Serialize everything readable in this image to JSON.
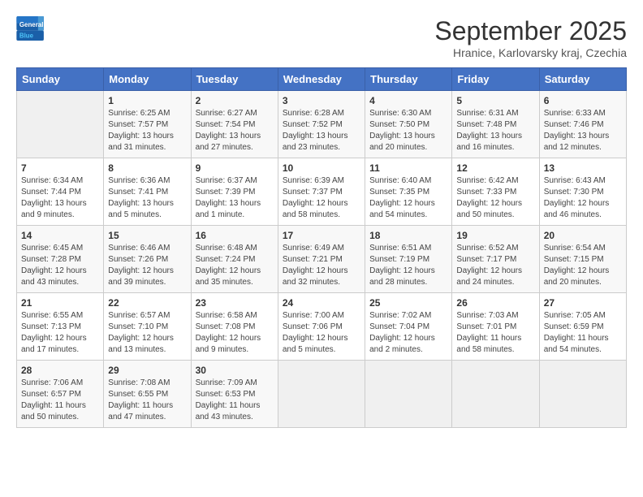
{
  "header": {
    "logo_general": "General",
    "logo_blue": "Blue",
    "month": "September 2025",
    "location": "Hranice, Karlovarsky kraj, Czechia"
  },
  "weekdays": [
    "Sunday",
    "Monday",
    "Tuesday",
    "Wednesday",
    "Thursday",
    "Friday",
    "Saturday"
  ],
  "weeks": [
    [
      {
        "day": "",
        "content": ""
      },
      {
        "day": "1",
        "content": "Sunrise: 6:25 AM\nSunset: 7:57 PM\nDaylight: 13 hours\nand 31 minutes."
      },
      {
        "day": "2",
        "content": "Sunrise: 6:27 AM\nSunset: 7:54 PM\nDaylight: 13 hours\nand 27 minutes."
      },
      {
        "day": "3",
        "content": "Sunrise: 6:28 AM\nSunset: 7:52 PM\nDaylight: 13 hours\nand 23 minutes."
      },
      {
        "day": "4",
        "content": "Sunrise: 6:30 AM\nSunset: 7:50 PM\nDaylight: 13 hours\nand 20 minutes."
      },
      {
        "day": "5",
        "content": "Sunrise: 6:31 AM\nSunset: 7:48 PM\nDaylight: 13 hours\nand 16 minutes."
      },
      {
        "day": "6",
        "content": "Sunrise: 6:33 AM\nSunset: 7:46 PM\nDaylight: 13 hours\nand 12 minutes."
      }
    ],
    [
      {
        "day": "7",
        "content": "Sunrise: 6:34 AM\nSunset: 7:44 PM\nDaylight: 13 hours\nand 9 minutes."
      },
      {
        "day": "8",
        "content": "Sunrise: 6:36 AM\nSunset: 7:41 PM\nDaylight: 13 hours\nand 5 minutes."
      },
      {
        "day": "9",
        "content": "Sunrise: 6:37 AM\nSunset: 7:39 PM\nDaylight: 13 hours\nand 1 minute."
      },
      {
        "day": "10",
        "content": "Sunrise: 6:39 AM\nSunset: 7:37 PM\nDaylight: 12 hours\nand 58 minutes."
      },
      {
        "day": "11",
        "content": "Sunrise: 6:40 AM\nSunset: 7:35 PM\nDaylight: 12 hours\nand 54 minutes."
      },
      {
        "day": "12",
        "content": "Sunrise: 6:42 AM\nSunset: 7:33 PM\nDaylight: 12 hours\nand 50 minutes."
      },
      {
        "day": "13",
        "content": "Sunrise: 6:43 AM\nSunset: 7:30 PM\nDaylight: 12 hours\nand 46 minutes."
      }
    ],
    [
      {
        "day": "14",
        "content": "Sunrise: 6:45 AM\nSunset: 7:28 PM\nDaylight: 12 hours\nand 43 minutes."
      },
      {
        "day": "15",
        "content": "Sunrise: 6:46 AM\nSunset: 7:26 PM\nDaylight: 12 hours\nand 39 minutes."
      },
      {
        "day": "16",
        "content": "Sunrise: 6:48 AM\nSunset: 7:24 PM\nDaylight: 12 hours\nand 35 minutes."
      },
      {
        "day": "17",
        "content": "Sunrise: 6:49 AM\nSunset: 7:21 PM\nDaylight: 12 hours\nand 32 minutes."
      },
      {
        "day": "18",
        "content": "Sunrise: 6:51 AM\nSunset: 7:19 PM\nDaylight: 12 hours\nand 28 minutes."
      },
      {
        "day": "19",
        "content": "Sunrise: 6:52 AM\nSunset: 7:17 PM\nDaylight: 12 hours\nand 24 minutes."
      },
      {
        "day": "20",
        "content": "Sunrise: 6:54 AM\nSunset: 7:15 PM\nDaylight: 12 hours\nand 20 minutes."
      }
    ],
    [
      {
        "day": "21",
        "content": "Sunrise: 6:55 AM\nSunset: 7:13 PM\nDaylight: 12 hours\nand 17 minutes."
      },
      {
        "day": "22",
        "content": "Sunrise: 6:57 AM\nSunset: 7:10 PM\nDaylight: 12 hours\nand 13 minutes."
      },
      {
        "day": "23",
        "content": "Sunrise: 6:58 AM\nSunset: 7:08 PM\nDaylight: 12 hours\nand 9 minutes."
      },
      {
        "day": "24",
        "content": "Sunrise: 7:00 AM\nSunset: 7:06 PM\nDaylight: 12 hours\nand 5 minutes."
      },
      {
        "day": "25",
        "content": "Sunrise: 7:02 AM\nSunset: 7:04 PM\nDaylight: 12 hours\nand 2 minutes."
      },
      {
        "day": "26",
        "content": "Sunrise: 7:03 AM\nSunset: 7:01 PM\nDaylight: 11 hours\nand 58 minutes."
      },
      {
        "day": "27",
        "content": "Sunrise: 7:05 AM\nSunset: 6:59 PM\nDaylight: 11 hours\nand 54 minutes."
      }
    ],
    [
      {
        "day": "28",
        "content": "Sunrise: 7:06 AM\nSunset: 6:57 PM\nDaylight: 11 hours\nand 50 minutes."
      },
      {
        "day": "29",
        "content": "Sunrise: 7:08 AM\nSunset: 6:55 PM\nDaylight: 11 hours\nand 47 minutes."
      },
      {
        "day": "30",
        "content": "Sunrise: 7:09 AM\nSunset: 6:53 PM\nDaylight: 11 hours\nand 43 minutes."
      },
      {
        "day": "",
        "content": ""
      },
      {
        "day": "",
        "content": ""
      },
      {
        "day": "",
        "content": ""
      },
      {
        "day": "",
        "content": ""
      }
    ]
  ]
}
